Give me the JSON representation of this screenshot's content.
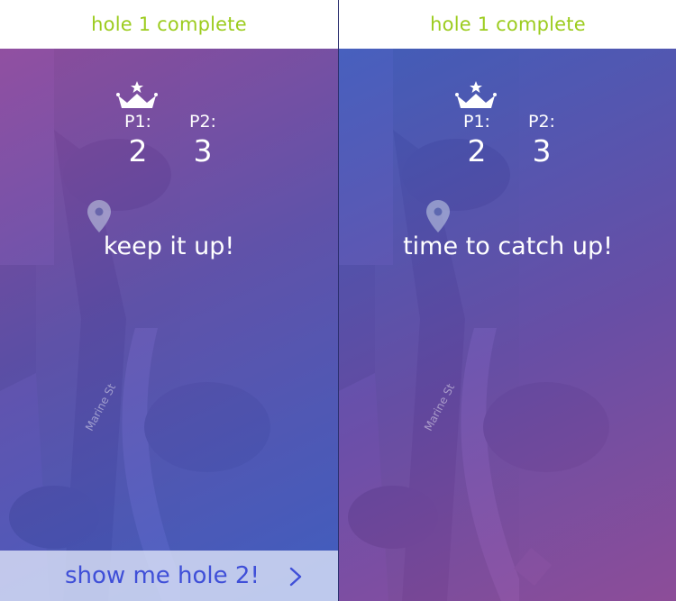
{
  "screens": [
    {
      "header_title": "hole 1 complete",
      "scores": [
        {
          "label": "P1:",
          "value": "2"
        },
        {
          "label": "P2:",
          "value": "3"
        }
      ],
      "message": "keep it up!",
      "street_label": "Marine St",
      "cta": {
        "label": "show me hole 2!",
        "icon": "chevron-right-icon"
      }
    },
    {
      "header_title": "hole 1 complete",
      "scores": [
        {
          "label": "P1:",
          "value": "2"
        },
        {
          "label": "P2:",
          "value": "3"
        }
      ],
      "message": "time to catch up!",
      "street_label": "Marine St"
    }
  ],
  "colors": {
    "header_text": "#9ccc1e",
    "cta_text": "#3f4fd8",
    "overlay_purple": "#9a47aa",
    "overlay_blue": "#3a5cd8"
  },
  "icons": [
    "crown-icon",
    "map-pin-icon",
    "chevron-right-icon"
  ]
}
